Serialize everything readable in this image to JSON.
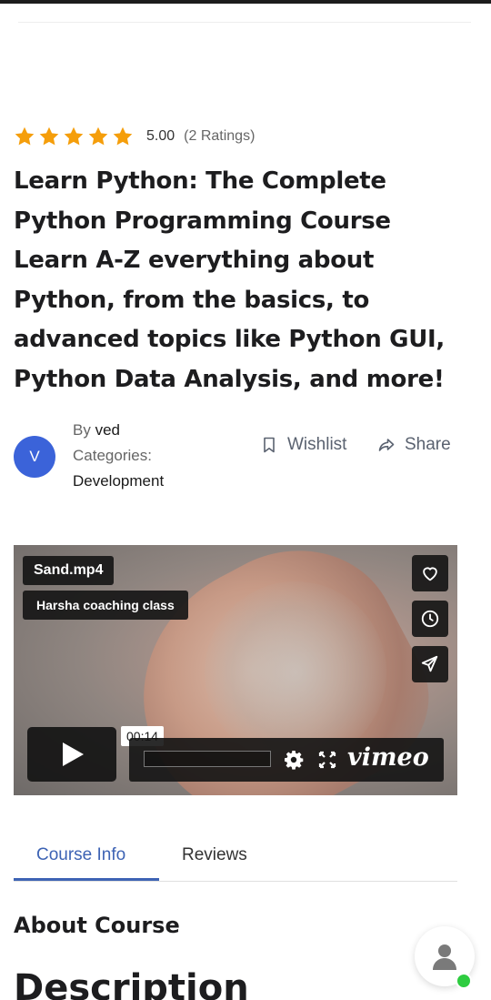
{
  "rating": {
    "value": "5.00",
    "count": "(2 Ratings)",
    "stars": 5,
    "star_color": "#f59e0b"
  },
  "course": {
    "title": "Learn Python: The Complete Python Programming Course Learn A-Z everything about Python, from the basics, to advanced topics like Python GUI, Python Data Analysis, and more!"
  },
  "author": {
    "avatar_letter": "V",
    "by_label": "By",
    "name": "ved",
    "categories_label": "Categories:",
    "category": "Development"
  },
  "actions": {
    "wishlist": "Wishlist",
    "share": "Share"
  },
  "video": {
    "filename": "Sand.mp4",
    "owner": "Harsha coaching class",
    "timestamp": "00:14",
    "player_brand": "vimeo",
    "side_icons": [
      "heart-icon",
      "clock-icon",
      "send-icon"
    ]
  },
  "tabs": [
    {
      "label": "Course Info",
      "active": true
    },
    {
      "label": "Reviews",
      "active": false
    }
  ],
  "sections": {
    "about": "About Course",
    "description": "Description"
  },
  "colors": {
    "accent": "#3d63b4",
    "avatar": "#3b63d9",
    "online": "#2ecc40"
  }
}
